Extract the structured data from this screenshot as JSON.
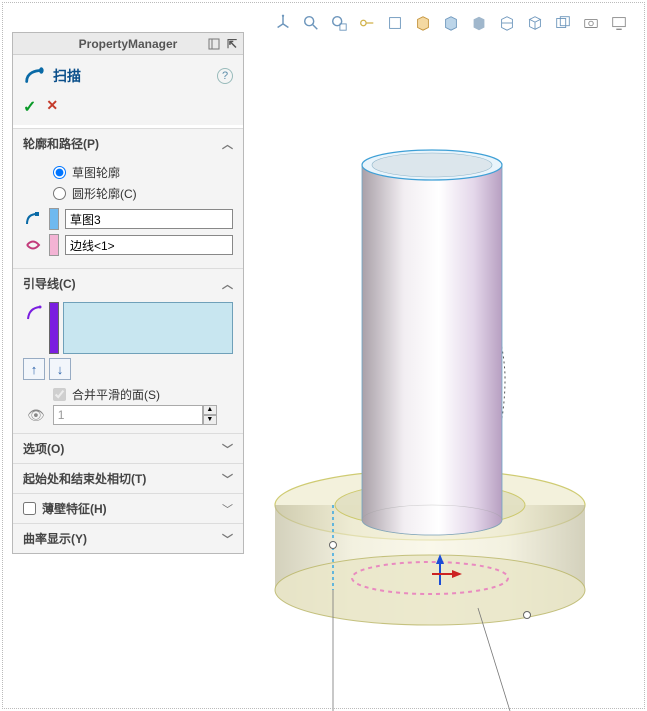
{
  "header": {
    "title": "PropertyManager"
  },
  "feature": {
    "name": "扫描",
    "help": "?"
  },
  "okbar": {
    "ok": "✓",
    "cancel": "✕"
  },
  "sections": {
    "profilePath": {
      "title": "轮廓和路径(P)",
      "radio_sketch": "草图轮廓",
      "radio_circular": "圆形轮廓(C)",
      "profile_field": "草图3",
      "path_field": "边线<1>"
    },
    "guides": {
      "title": "引导线(C)",
      "merge_label": "合并平滑的面(S)",
      "visibility_value": "1"
    },
    "options": {
      "title": "选项(O)"
    },
    "startEnd": {
      "title": "起始处和结束处相切(T)"
    },
    "thin": {
      "title": "薄壁特征(H)"
    },
    "curvature": {
      "title": "曲率显示(Y)"
    }
  },
  "chevrons": {
    "expand": "︿",
    "collapse": "﹀"
  },
  "toolbar": {
    "icons": [
      "view-orientation-icon",
      "zoom-to-fit-icon",
      "zoom-area-icon",
      "zoom-selection-icon",
      "view-wireframe-icon",
      "hidden-lines-icon",
      "shaded-edges-icon",
      "shaded-icon",
      "section-view-icon",
      "isometric-icon",
      "display-style-icon",
      "snapshot-icon",
      "screen-icon"
    ]
  }
}
